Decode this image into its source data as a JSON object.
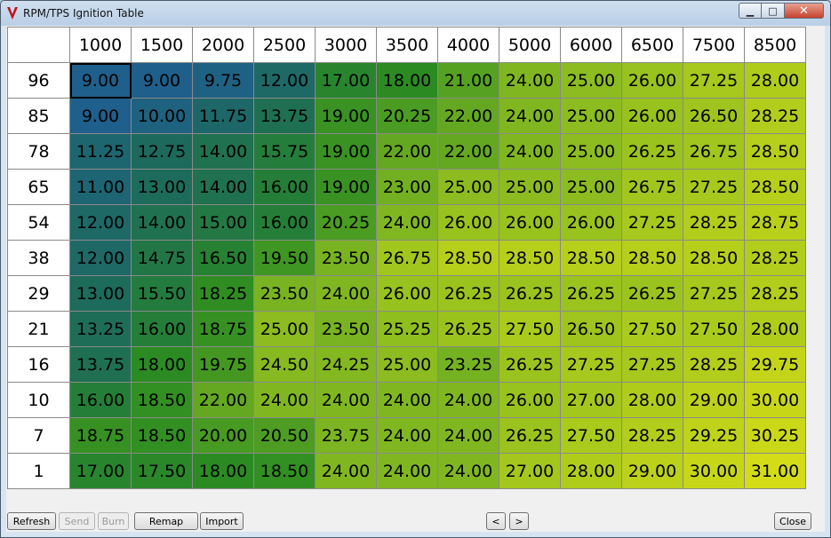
{
  "window": {
    "title": "RPM/TPS Ignition Table",
    "controls": {
      "minimize": "▁",
      "maximize": "□",
      "close": "✕"
    }
  },
  "table": {
    "column_headers": [
      "1000",
      "1500",
      "2000",
      "2500",
      "3000",
      "3500",
      "4000",
      "5000",
      "6000",
      "6500",
      "7500",
      "8500"
    ],
    "row_headers": [
      "96",
      "85",
      "78",
      "65",
      "54",
      "38",
      "29",
      "21",
      "16",
      "10",
      "7",
      "1"
    ],
    "rows": [
      [
        "9.00",
        "9.00",
        "9.75",
        "12.00",
        "17.00",
        "18.00",
        "21.00",
        "24.00",
        "25.00",
        "26.00",
        "27.25",
        "28.00"
      ],
      [
        "9.00",
        "10.00",
        "11.75",
        "13.75",
        "19.00",
        "20.25",
        "22.00",
        "24.00",
        "25.00",
        "26.00",
        "26.50",
        "28.25"
      ],
      [
        "11.25",
        "12.75",
        "14.00",
        "15.75",
        "19.00",
        "22.00",
        "22.00",
        "24.00",
        "25.00",
        "26.25",
        "26.75",
        "28.50"
      ],
      [
        "11.00",
        "13.00",
        "14.00",
        "16.00",
        "19.00",
        "23.00",
        "25.00",
        "25.00",
        "25.00",
        "26.75",
        "27.25",
        "28.50"
      ],
      [
        "12.00",
        "14.00",
        "15.00",
        "16.00",
        "20.25",
        "24.00",
        "26.00",
        "26.00",
        "26.00",
        "27.25",
        "28.25",
        "28.75"
      ],
      [
        "12.00",
        "14.75",
        "16.50",
        "19.50",
        "23.50",
        "26.75",
        "28.50",
        "28.50",
        "28.50",
        "28.50",
        "28.50",
        "28.25"
      ],
      [
        "13.00",
        "15.50",
        "18.25",
        "23.50",
        "24.00",
        "26.00",
        "26.25",
        "26.25",
        "26.25",
        "26.25",
        "27.25",
        "28.25"
      ],
      [
        "13.25",
        "16.00",
        "18.75",
        "25.00",
        "23.50",
        "25.25",
        "26.25",
        "27.50",
        "26.50",
        "27.50",
        "27.50",
        "28.00"
      ],
      [
        "13.75",
        "18.00",
        "19.75",
        "24.50",
        "24.25",
        "25.00",
        "23.25",
        "26.25",
        "27.25",
        "27.25",
        "28.25",
        "29.75"
      ],
      [
        "16.00",
        "18.50",
        "22.00",
        "24.00",
        "24.00",
        "24.00",
        "24.00",
        "26.00",
        "27.00",
        "28.00",
        "29.00",
        "30.00"
      ],
      [
        "18.75",
        "18.50",
        "20.00",
        "20.50",
        "23.75",
        "24.00",
        "24.00",
        "26.25",
        "27.50",
        "28.25",
        "29.25",
        "30.25"
      ],
      [
        "17.00",
        "17.50",
        "18.00",
        "18.50",
        "24.00",
        "24.00",
        "24.00",
        "27.00",
        "28.00",
        "29.00",
        "30.00",
        "31.00"
      ]
    ],
    "selected_cell": {
      "row": 0,
      "col": 0
    },
    "color_scale": {
      "stops": [
        {
          "value": 9.0,
          "color": "#1f5f8b"
        },
        {
          "value": 13.0,
          "color": "#1d6b5a"
        },
        {
          "value": 18.0,
          "color": "#2b8b22"
        },
        {
          "value": 24.0,
          "color": "#80b721"
        },
        {
          "value": 31.0,
          "color": "#d3dc17"
        }
      ]
    }
  },
  "buttons": {
    "refresh": "Refresh",
    "send": "Send",
    "burn": "Burn",
    "remap": "Remap",
    "import": "Import",
    "prev": "<",
    "next": ">",
    "close": "Close"
  }
}
